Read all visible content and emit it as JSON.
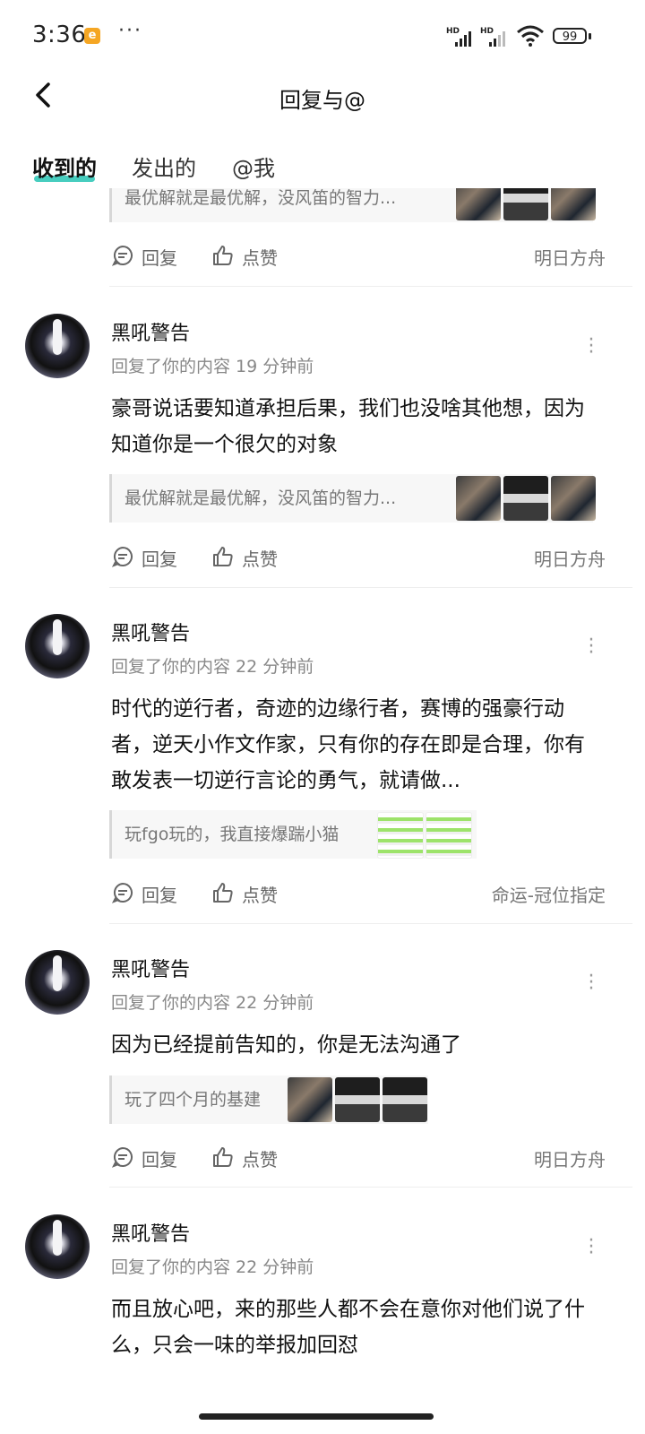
{
  "status_bar": {
    "time": "3:36",
    "app_badge": "e",
    "more": "···",
    "signal_1": "HD",
    "signal_2": "HD",
    "battery": "99"
  },
  "header": {
    "title": "回复与@"
  },
  "tabs": [
    {
      "label": "收到的",
      "active": true
    },
    {
      "label": "发出的",
      "active": false
    },
    {
      "label": "@我",
      "active": false
    }
  ],
  "actions": {
    "reply": "回复",
    "like": "点赞"
  },
  "items": [
    {
      "partial": true,
      "quote": "最优解就是最优解，没风笛的智力...",
      "source": "明日方舟"
    },
    {
      "user": "黑吼警告",
      "meta": "回复了你的内容 19 分钟前",
      "content": "豪哥说话要知道承担后果，我们也没啥其他想，因为知道你是一个很欠的对象",
      "quote": "最优解就是最优解，没风笛的智力...",
      "source": "明日方舟"
    },
    {
      "user": "黑吼警告",
      "meta": "回复了你的内容 22 分钟前",
      "content": "时代的逆行者，奇迹的边缘行者，赛博的强豪行动者，逆天小作文作家，只有你的存在即是合理，你有敢发表一切逆行言论的勇气，就请做...",
      "quote": "玩fgo玩的，我直接爆踹小猫",
      "source": "命运-冠位指定"
    },
    {
      "user": "黑吼警告",
      "meta": "回复了你的内容 22 分钟前",
      "content": "因为已经提前告知的，你是无法沟通了",
      "quote": "玩了四个月的基建",
      "source": "明日方舟"
    },
    {
      "user": "黑吼警告",
      "meta": "回复了你的内容 22 分钟前",
      "content": "而且放心吧，来的那些人都不会在意你对他们说了什么，只会一味的举报加回怼"
    }
  ]
}
